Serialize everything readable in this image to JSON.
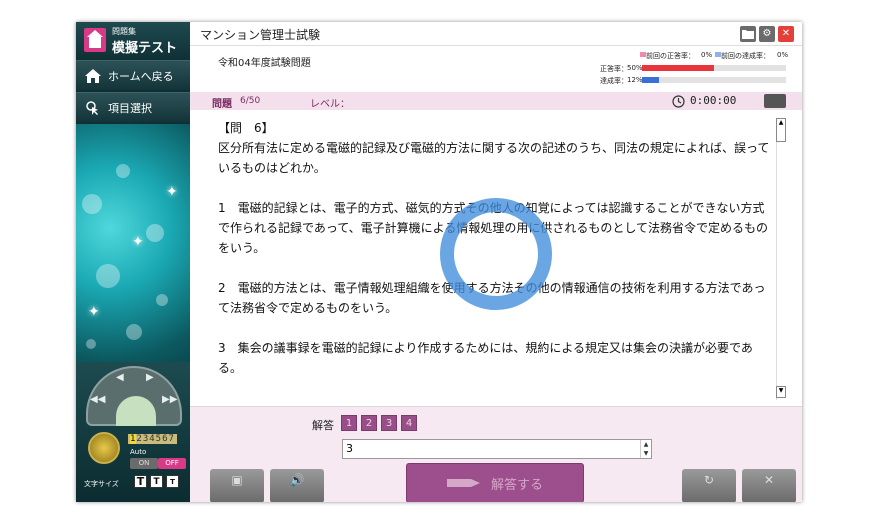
{
  "sidebar": {
    "logo_sub": "問題集",
    "logo_title": "模擬テスト",
    "nav": [
      {
        "label": "ホームへ戻る",
        "icon": "home-icon"
      },
      {
        "label": "項目選択",
        "icon": "cursor-icon"
      }
    ],
    "controls": {
      "counter_first": "1",
      "counter_rest": "234567",
      "auto_label": "Auto",
      "on_label": "ON",
      "off_label": "OFF",
      "fontsize_label": "文字サイズ",
      "fontsize_buttons": [
        "T",
        "T",
        "T"
      ]
    }
  },
  "window": {
    "title": "マンション管理士試験",
    "buttons": [
      {
        "icon": "folder-icon",
        "color": "#6b6b6b"
      },
      {
        "icon": "gear-icon",
        "color": "#6b6b6b"
      },
      {
        "icon": "close-icon",
        "color": "#e4403a"
      }
    ]
  },
  "exam": {
    "title": "令和04年度試験問題",
    "prev_correct_label": "前回の正答率：",
    "prev_correct_value": "0%",
    "prev_achieve_label": "前回の達成率：",
    "prev_achieve_value": "0%",
    "correct_label": "正答率：",
    "correct_value": "50%",
    "correct_ratio": 0.5,
    "achieve_label": "達成率：",
    "achieve_value": "12%",
    "achieve_ratio": 0.12,
    "colors": {
      "correct": "#e8343a",
      "achieve": "#3a6fd8",
      "prev_correct": "#f08aa8",
      "prev_achieve": "#8fb3e6"
    }
  },
  "question_header": {
    "label": "問題",
    "number": "6/50",
    "level_label": "レベル：",
    "timer": "0:00:00"
  },
  "question": {
    "heading": "【問　6】",
    "paragraphs": [
      "区分所有法に定める電磁的記録及び電磁的方法に関する次の記述のうち、同法の規定によれば、誤っているものはどれか。",
      "1　電磁的記録とは、電子的方式、磁気的方式その他人の知覚によっては認識することができない方式で作られる記録であって、電子計算機による情報処理の用に供されるものとして法務省令で定めるものをいう。",
      "2　電磁的方法とは、電子情報処理組織を使用する方法その他の情報通信の技術を利用する方法であって法務省令で定めるものをいう。",
      "3　集会の議事録を電磁的記録により作成するためには、規約による規定又は集会の決議が必要である。"
    ]
  },
  "answer": {
    "label": "解答",
    "choices": [
      "1",
      "2",
      "3",
      "4"
    ],
    "input_value": "3",
    "submit_label": "解答する"
  }
}
